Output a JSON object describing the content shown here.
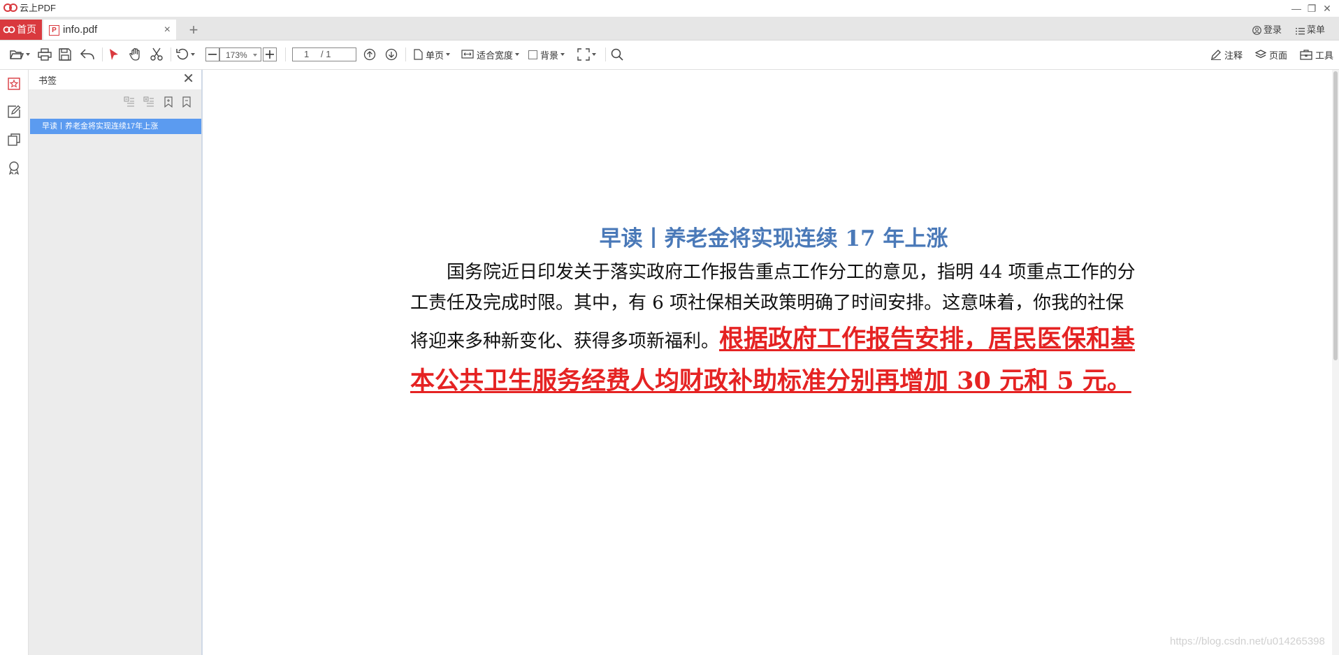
{
  "app": {
    "name": "云上PDF",
    "window_controls": [
      "—",
      "❐",
      "✕"
    ]
  },
  "tabs": {
    "home_label": "首页",
    "file_label": "info.pdf",
    "close_symbol": "×",
    "add_symbol": "+"
  },
  "topbar": {
    "login_label": "登录",
    "menu_label": "菜单"
  },
  "toolbar": {
    "zoom_value": "173%",
    "page_current": "1",
    "page_total": "/ 1",
    "single_page_label": "单页",
    "fit_width_label": "适合宽度",
    "background_label": "背景",
    "annotate_label": "注释",
    "page_label": "页面",
    "tools_label": "工具",
    "icons": [
      "open-folder-icon",
      "print-icon",
      "save-icon",
      "undo-icon",
      "select-arrow-icon",
      "hand-icon",
      "scissors-icon",
      "rotate-icon",
      "zoom-out-icon",
      "zoom-in-icon",
      "prev-page-icon",
      "next-page-icon",
      "single-page-icon",
      "fit-width-icon",
      "fullscreen-icon",
      "search-icon",
      "pencil-icon",
      "layers-icon",
      "toolbox-icon"
    ]
  },
  "sidebar": {
    "rail_icons": [
      "bookmark-rail-icon",
      "edit-rail-icon",
      "pages-rail-icon",
      "badge-rail-icon"
    ]
  },
  "bookmark_panel": {
    "title": "书签",
    "close_symbol": "✕",
    "items": [
      {
        "label": "早读丨养老金将实现连续17年上涨"
      }
    ]
  },
  "document": {
    "headline": "早读丨养老金将实现连续 17 年上涨",
    "body": "国务院近日印发关于落实政府工作报告重点工作分工的意见，指明 44 项重点工作的分工责任及完成时限。其中，有 6 项社保相关政策明确了时间安排。这意味着，你我的社保将迎来多种新变化、获得多项新福利。",
    "highlight": "根据政府工作报告安排，居民医保和基本公共卫生服务经费人均财政补助标准分别再增加 30 元和 5 元。"
  },
  "watermark": "https://blog.csdn.net/u014265398",
  "colors": {
    "brand_red": "#d9393e",
    "headline_blue": "#4a79b8",
    "highlight_red": "#e52323",
    "selection_blue": "#5b9bf0"
  }
}
